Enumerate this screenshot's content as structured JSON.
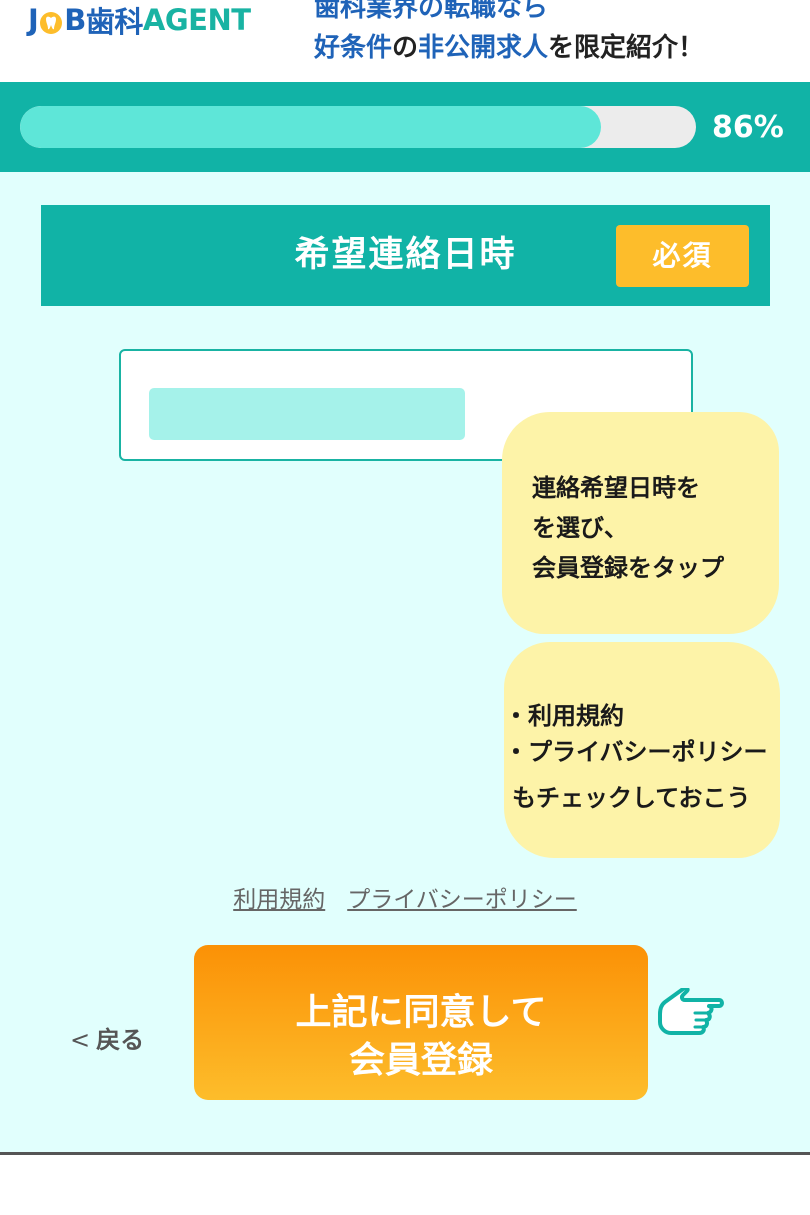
{
  "header": {
    "logo": {
      "job": "J",
      "job_b": "B",
      "shika": "歯科",
      "agent": "AGENT"
    },
    "tagline_line1": "歯科業界の転職なら",
    "tagline_line2": {
      "a": "好条件",
      "b": "の",
      "c": "非公開求人",
      "d": "を限定紹介！"
    }
  },
  "progress": {
    "value": 0.86,
    "label": "86%"
  },
  "section": {
    "title": "希望連絡日時",
    "required_badge": "必須"
  },
  "note1": {
    "lines": [
      "連絡希望日時を",
      "を選び、",
      "会員登録をタップ"
    ]
  },
  "note2": {
    "lines": [
      "・利用規約",
      "・プライバシーポリシー",
      "もチェックしておこう"
    ]
  },
  "links": {
    "terms": "利用規約",
    "privacy": "プライバシーポリシー"
  },
  "back": {
    "chevron": "<",
    "label": "戻る"
  },
  "submit": {
    "line1": "上記に同意して",
    "line2": "会員登録"
  },
  "colors": {
    "teal": "#11b3a6",
    "progress_fill": "#5ee6d8",
    "background": "#e1fffd",
    "badge": "#fdbd2b",
    "button_top": "#fb9106",
    "button_bottom": "#fdbd2b",
    "note": "#fdf3a8"
  },
  "icons": {
    "logo_tooth": "tooth-icon",
    "hand": "pointing-hand-icon"
  }
}
